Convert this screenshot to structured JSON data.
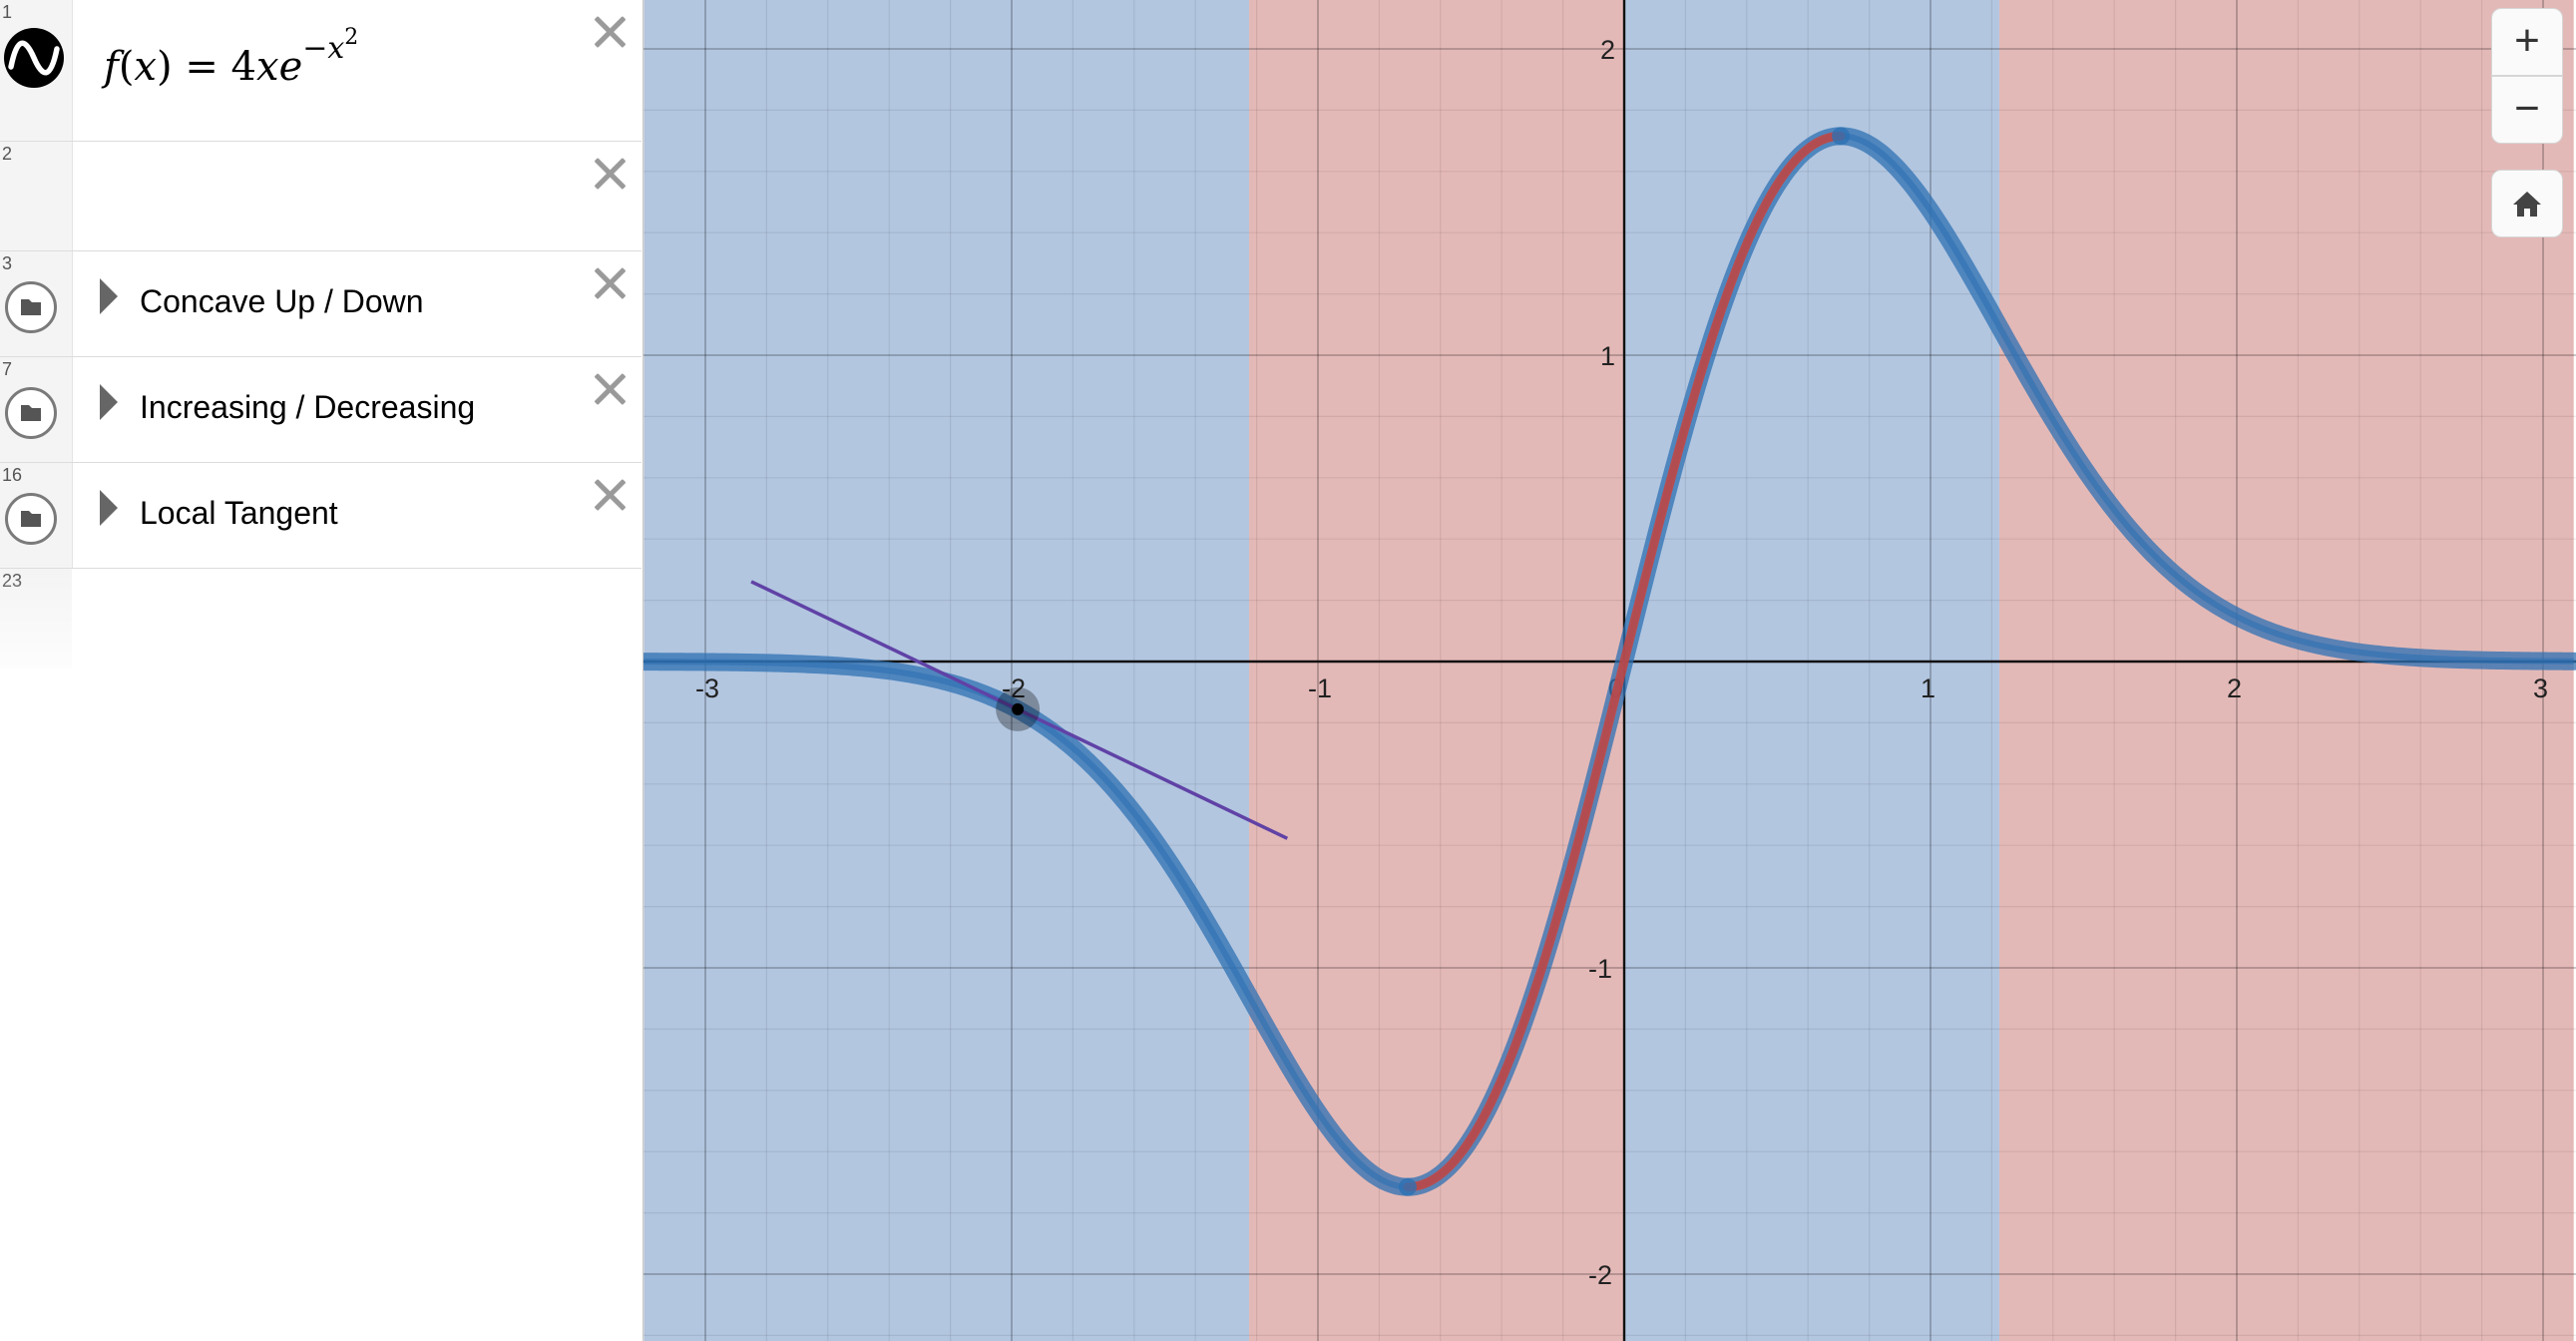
{
  "expressions": [
    {
      "num": "1",
      "latex_plain": "f(x) = 4xe^{-x^2}",
      "func": "f",
      "var": "x",
      "coef": "4",
      "base": "e",
      "exp_sign": "−",
      "exp_var": "x",
      "exp_pow": "2"
    },
    {
      "num": "2",
      "latex_plain": ""
    },
    {
      "num": "3",
      "label": "Concave Up / Down"
    },
    {
      "num": "7",
      "label": "Increasing / Decreasing"
    },
    {
      "num": "16",
      "label": "Local Tangent"
    },
    {
      "num": "23"
    }
  ],
  "icons": {
    "logo": "desmos-wave-icon",
    "delete": "close-icon",
    "folder": "folder-icon",
    "expand": "triangle-right-icon",
    "zoom_in": "plus-icon",
    "zoom_out": "minus-icon",
    "home": "home-icon"
  },
  "zoom": {
    "in_label": "+",
    "out_label": "−"
  },
  "colors": {
    "curve_blue": "#2d70b3",
    "curve_red": "#c74440",
    "tangent": "#6042a6",
    "shade_blue": "#aec3de",
    "shade_red": "#e2b5b3"
  },
  "chart_data": {
    "type": "line",
    "function": "f(x) = 4x*e^(-x^2)",
    "xlim": [
      -3.2,
      3.1
    ],
    "ylim": [
      -2.2,
      2.18
    ],
    "grid": true,
    "x_ticks": [
      "-3",
      "-2",
      "-1",
      "0",
      "1",
      "2",
      "3"
    ],
    "y_ticks": [
      "2",
      "1",
      "-1",
      "-2"
    ],
    "series": [
      {
        "color": "#2d70b3",
        "domain": [
          -3.2,
          3.1
        ],
        "role": "concave"
      },
      {
        "color": "#c74440",
        "domain": [
          -0.7071,
          0.7071
        ],
        "role": "increasing"
      }
    ],
    "shaded_regions": [
      {
        "color": "#c74440",
        "x_range": [
          -1.2247,
          0
        ]
      },
      {
        "color": "#c74440",
        "x_range": [
          1.2247,
          3.1
        ]
      },
      {
        "color": "#2d70b3",
        "x_range": [
          -3.2,
          -1.2247
        ]
      },
      {
        "color": "#2d70b3",
        "x_range": [
          0,
          1.2247
        ]
      }
    ],
    "tangent": {
      "point": [
        -1.98,
        -0.156
      ],
      "slope": -0.479,
      "x_range": [
        -2.85,
        -1.1
      ],
      "color": "#6042a6"
    },
    "extrema_points": [
      [
        -0.7071,
        -1.7155
      ],
      [
        0.7071,
        1.7155
      ]
    ]
  }
}
